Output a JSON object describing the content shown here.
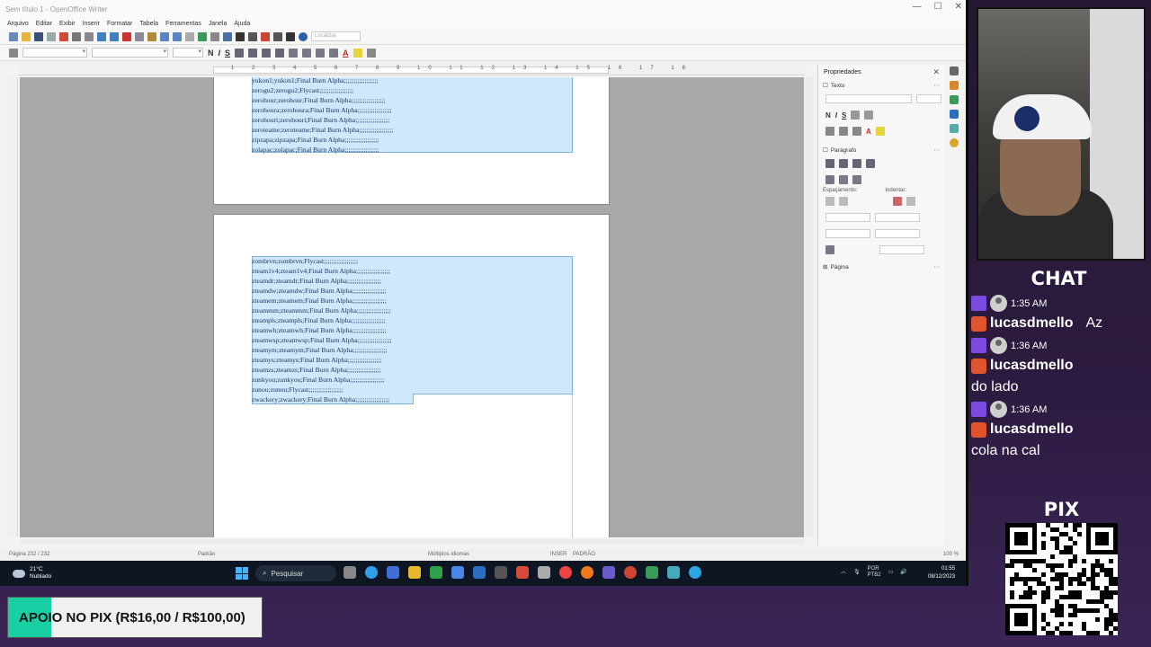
{
  "window": {
    "title": "Sem título 1 - OpenOffice Writer",
    "controls": [
      "—",
      "☐",
      "✕"
    ]
  },
  "menu": [
    "Arquivo",
    "Editar",
    "Exibir",
    "Inserir",
    "Formatar",
    "Tabela",
    "Ferramentas",
    "Janela",
    "Ajuda"
  ],
  "toolbar": {
    "find_placeholder": "Localizar"
  },
  "formatting": {
    "bold": "N",
    "italic": "I",
    "underline": "S",
    "font_color": "A"
  },
  "ruler": {
    "numbers": "1 2 3 4 5 6 7 8 9 10 11 12 13 14 15 16 17 18"
  },
  "document": {
    "page1_lines": [
      "yukon1;yukon1;Final Burn Alpha;;;;;;;;;;;;;;;;;;",
      "zerogu2;zerogu2;Flycast;;;;;;;;;;;;;;;;;;",
      "zerohour;zerohour;Final Burn Alpha;;;;;;;;;;;;;;;;;;",
      "zerohoura;zerohoura;Final Burn Alpha;;;;;;;;;;;;;;;;;;",
      "zerohouri;zerohouri;Final Burn Alpha;;;;;;;;;;;;;;;;;;",
      "zeroteame;zeroteame;Final Burn Alpha;;;;;;;;;;;;;;;;;;",
      "zipzapa;zipzapa;Final Burn Alpha;;;;;;;;;;;;;;;;;;",
      "zolapac;zolapac;Final Burn Alpha;;;;;;;;;;;;;;;;;;"
    ],
    "page2_lines": [
      "zombrvn;zombrvn;Flycast;;;;;;;;;;;;;;;;;;",
      "zteam1v4;zteam1v4;Final Burn Alpha;;;;;;;;;;;;;;;;;;",
      "zteamdr;zteamdr;Final Burn Alpha;;;;;;;;;;;;;;;;;;",
      "zteamdw;zteamdw;Final Burn Alpha;;;;;;;;;;;;;;;;;;",
      "zteamem;zteamem;Final Burn Alpha;;;;;;;;;;;;;;;;;;",
      "zteammm;zteammm;Final Burn Alpha;;;;;;;;;;;;;;;;;;",
      "zteampls;zteampls;Final Burn Alpha;;;;;;;;;;;;;;;;;;",
      "zteamwh;zteamwh;Final Burn Alpha;;;;;;;;;;;;;;;;;;",
      "zteamwsp;zteamwsp;Final Burn Alpha;;;;;;;;;;;;;;;;;;",
      "zteamym;zteamym;Final Burn Alpha;;;;;;;;;;;;;;;;;;",
      "zteamys;zteamys;Final Burn Alpha;;;;;;;;;;;;;;;;;;",
      "zteamzs;zteamzs;Final Burn Alpha;;;;;;;;;;;;;;;;;;",
      "zunkyou;zunkyou;Final Burn Alpha;;;;;;;;;;;;;;;;;;",
      "zunou;zunou;Flycast;;;;;;;;;;;;;;;;;;",
      "zwackery;zwackery;Final Burn Alpha;;;;;;;;;;;;;;;;;;"
    ]
  },
  "sidebar": {
    "title": "Propriedades",
    "close": "✕",
    "text_section": "Texto",
    "paragraph_section": "Parágrafo",
    "spacing_label": "Espaçamento:",
    "indent_label": "Indentar:",
    "page_section": "Página"
  },
  "status": {
    "page": "Página 232 / 232",
    "style": "Padrão",
    "language": "Múltiplos idiomas",
    "insert": "INSER",
    "selection": "PADRÃO",
    "zoom": "100 %"
  },
  "taskbar": {
    "temp": "21°C",
    "weather": "Nublado",
    "search": "Pesquisar",
    "lang": "POR",
    "layout": "PTB2",
    "time": "01:55",
    "date": "08/12/2023"
  },
  "chat": {
    "title": "CHAT",
    "messages": [
      {
        "time": "1:35 AM",
        "user": "lucasdmello",
        "text": "Az"
      },
      {
        "time": "1:36 AM",
        "user": "lucasdmello",
        "text": "do lado"
      },
      {
        "time": "1:36 AM",
        "user": "lucasdmello",
        "text": "cola na cal"
      }
    ]
  },
  "pix": {
    "title": "PIX"
  },
  "support": {
    "text": "APOIO NO PIX (R$16,00 / R$100,00)"
  },
  "colors": {
    "selection": "#cfe8fb",
    "twitch": "#7d4ae0",
    "pix_accent": "#19d0a4",
    "stream_bg": "#2c1b40"
  }
}
